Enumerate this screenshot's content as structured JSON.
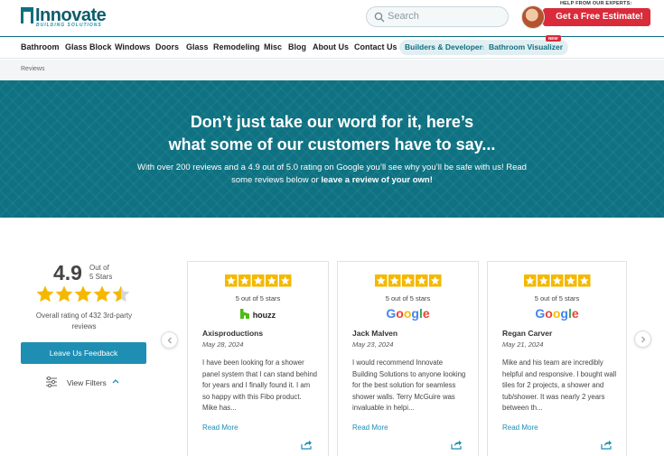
{
  "header": {
    "logo_name": "Innovate",
    "logo_tagline": "BUILDING SOLUTIONS",
    "search_placeholder": "Search",
    "help_text": "HELP FROM OUR EXPERTS:",
    "estimate_label": "Get a Free Estimate!"
  },
  "nav": {
    "items": [
      "Bathroom",
      "Glass Block",
      "Windows",
      "Doors",
      "Glass",
      "Remodeling",
      "Misc",
      "Blog",
      "About Us",
      "Contact Us"
    ],
    "pill_builders": "Builders & Developers",
    "pill_visualizer": "Bathroom Visualizer",
    "new_badge": "NEW"
  },
  "breadcrumb": "Reviews",
  "hero": {
    "title_line1": "Don’t just take our word for it, here’s",
    "title_line2": "what some of our customers have to say...",
    "sub_line1": "With over 200 reviews and a 4.9 out of 5.0 rating on Google you’ll see why you’ll be safe with us! Read",
    "sub_line2_a": "some reviews below or ",
    "sub_line2_b": "leave a review of your own!"
  },
  "summary": {
    "rating": "4.9",
    "out_of_line1": "Out of",
    "out_of_line2": "5 Stars",
    "stars": 4.5,
    "overall_line1": "Overall rating of 432 3rd-party",
    "overall_line2": "reviews",
    "feedback_button": "Leave Us Feedback",
    "filters_label": "View Filters"
  },
  "reviews": [
    {
      "stars_text": "5 out of 5 stars",
      "source": "houzz",
      "name": "Axisproductions",
      "date": "May 28, 2024",
      "text": "I have been looking for a shower panel system that I can stand behind for years and I finally found it. I am so happy with this Fibo product. Mike has...",
      "read_more": "Read More"
    },
    {
      "stars_text": "5 out of 5 stars",
      "source": "Google",
      "name": "Jack Malven",
      "date": "May 23, 2024",
      "text": "I would recommend Innovate Building Solutions to anyone looking for the best solution for seamless shower walls. Terry McGuire was invaluable in helpi...",
      "read_more": "Read More"
    },
    {
      "stars_text": "5 out of 5 stars",
      "source": "Google",
      "name": "Regan Carver",
      "date": "May 21, 2024",
      "text": "Mike and his team are incredibly helpful and responsive. I bought wall tiles for 2 projects, a shower and tub/shower. It was nearly 2 years between th...",
      "read_more": "Read More"
    }
  ],
  "colors": {
    "teal": "#0f7282",
    "accent_blue": "#1e8fb3",
    "red": "#d92b3a",
    "star": "#f5b800"
  }
}
